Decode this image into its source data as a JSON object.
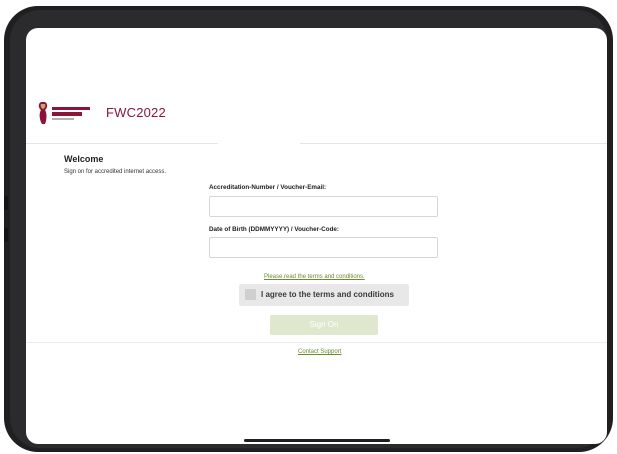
{
  "brand": {
    "logo_text": "FIFA WORLD CUP Qatar 2022",
    "title": "FWC2022"
  },
  "intro": {
    "heading": "Welcome",
    "subtitle": "Sign on for accredited internet access."
  },
  "form": {
    "accreditation_label": "Accreditation-Number / Voucher-Email:",
    "accreditation_value": "",
    "dob_label": "Date of Birth (DDMMYYYY) / Voucher-Code:",
    "dob_value": "",
    "terms_link": "Please read the terms and conditions.",
    "agree_label": "I agree to the terms and conditions",
    "agree_checked": false,
    "signon_button": "Sign On"
  },
  "footer": {
    "contact_link": "Contact Support"
  },
  "colors": {
    "brand_maroon": "#8a1538",
    "link_green": "#6a8a2d",
    "button_disabled": "#dfe7cf"
  }
}
